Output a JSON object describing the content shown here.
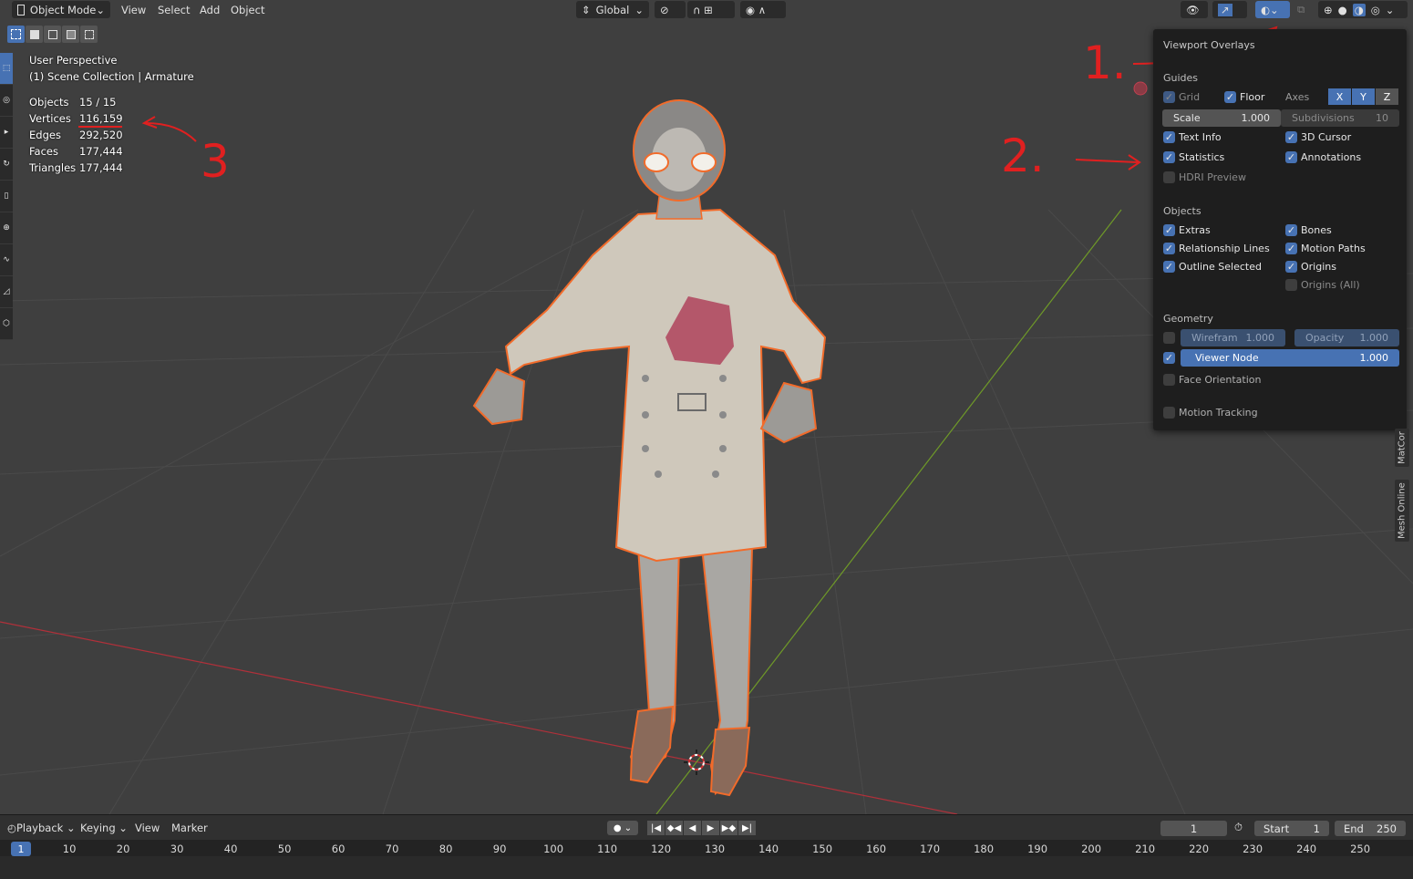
{
  "header": {
    "mode": "Object Mode",
    "menus": [
      "View",
      "Select",
      "Add",
      "Object"
    ],
    "transform_orientation": "Global"
  },
  "viewport_info": {
    "perspective": "User Perspective",
    "collection": "(1) Scene Collection | Armature"
  },
  "stats": [
    {
      "label": "Objects",
      "value": "15 / 15"
    },
    {
      "label": "Vertices",
      "value": "116,159"
    },
    {
      "label": "Edges",
      "value": "292,520"
    },
    {
      "label": "Faces",
      "value": "177,444"
    },
    {
      "label": "Triangles",
      "value": "177,444"
    }
  ],
  "annotations": {
    "one": "1.",
    "two": "2.",
    "three": "3"
  },
  "overlays": {
    "title": "Viewport Overlays",
    "guides_label": "Guides",
    "grid": "Grid",
    "floor": "Floor",
    "axes": "Axes",
    "axis_x": "X",
    "axis_y": "Y",
    "axis_z": "Z",
    "scale_label": "Scale",
    "scale_value": "1.000",
    "subdivisions_label": "Subdivisions",
    "subdivisions_value": "10",
    "text_info": "Text Info",
    "cursor_3d": "3D Cursor",
    "statistics": "Statistics",
    "annotations": "Annotations",
    "hdri_preview": "HDRI Preview",
    "objects_label": "Objects",
    "extras": "Extras",
    "bones": "Bones",
    "relationship_lines": "Relationship Lines",
    "motion_paths": "Motion Paths",
    "outline_selected": "Outline Selected",
    "origins": "Origins",
    "origins_all": "Origins (All)",
    "geometry_label": "Geometry",
    "wireframe_label": "Wirefram",
    "wireframe_value": "1.000",
    "opacity_label": "Opacity",
    "opacity_value": "1.000",
    "viewer_node_label": "Viewer Node",
    "viewer_node_value": "1.000",
    "face_orientation": "Face Orientation",
    "motion_tracking": "Motion Tracking"
  },
  "side_tabs": [
    "MatCor",
    "Mesh Online"
  ],
  "timeline": {
    "menus": [
      "Playback",
      "Keying",
      "View",
      "Marker"
    ],
    "current_frame": "1",
    "frame_field": "1",
    "start_label": "Start",
    "start_value": "1",
    "end_label": "End",
    "end_value": "250",
    "ruler": [
      "1",
      "10",
      "20",
      "30",
      "40",
      "50",
      "60",
      "70",
      "80",
      "90",
      "100",
      "110",
      "120",
      "130",
      "140",
      "150",
      "160",
      "170",
      "180",
      "190",
      "200",
      "210",
      "220",
      "230",
      "240",
      "250"
    ]
  },
  "colors": {
    "accent": "#4772b3",
    "outline": "#f26b2a",
    "annotation": "#e02020",
    "x_axis": "#b0303a",
    "y_axis": "#6f9a28"
  }
}
